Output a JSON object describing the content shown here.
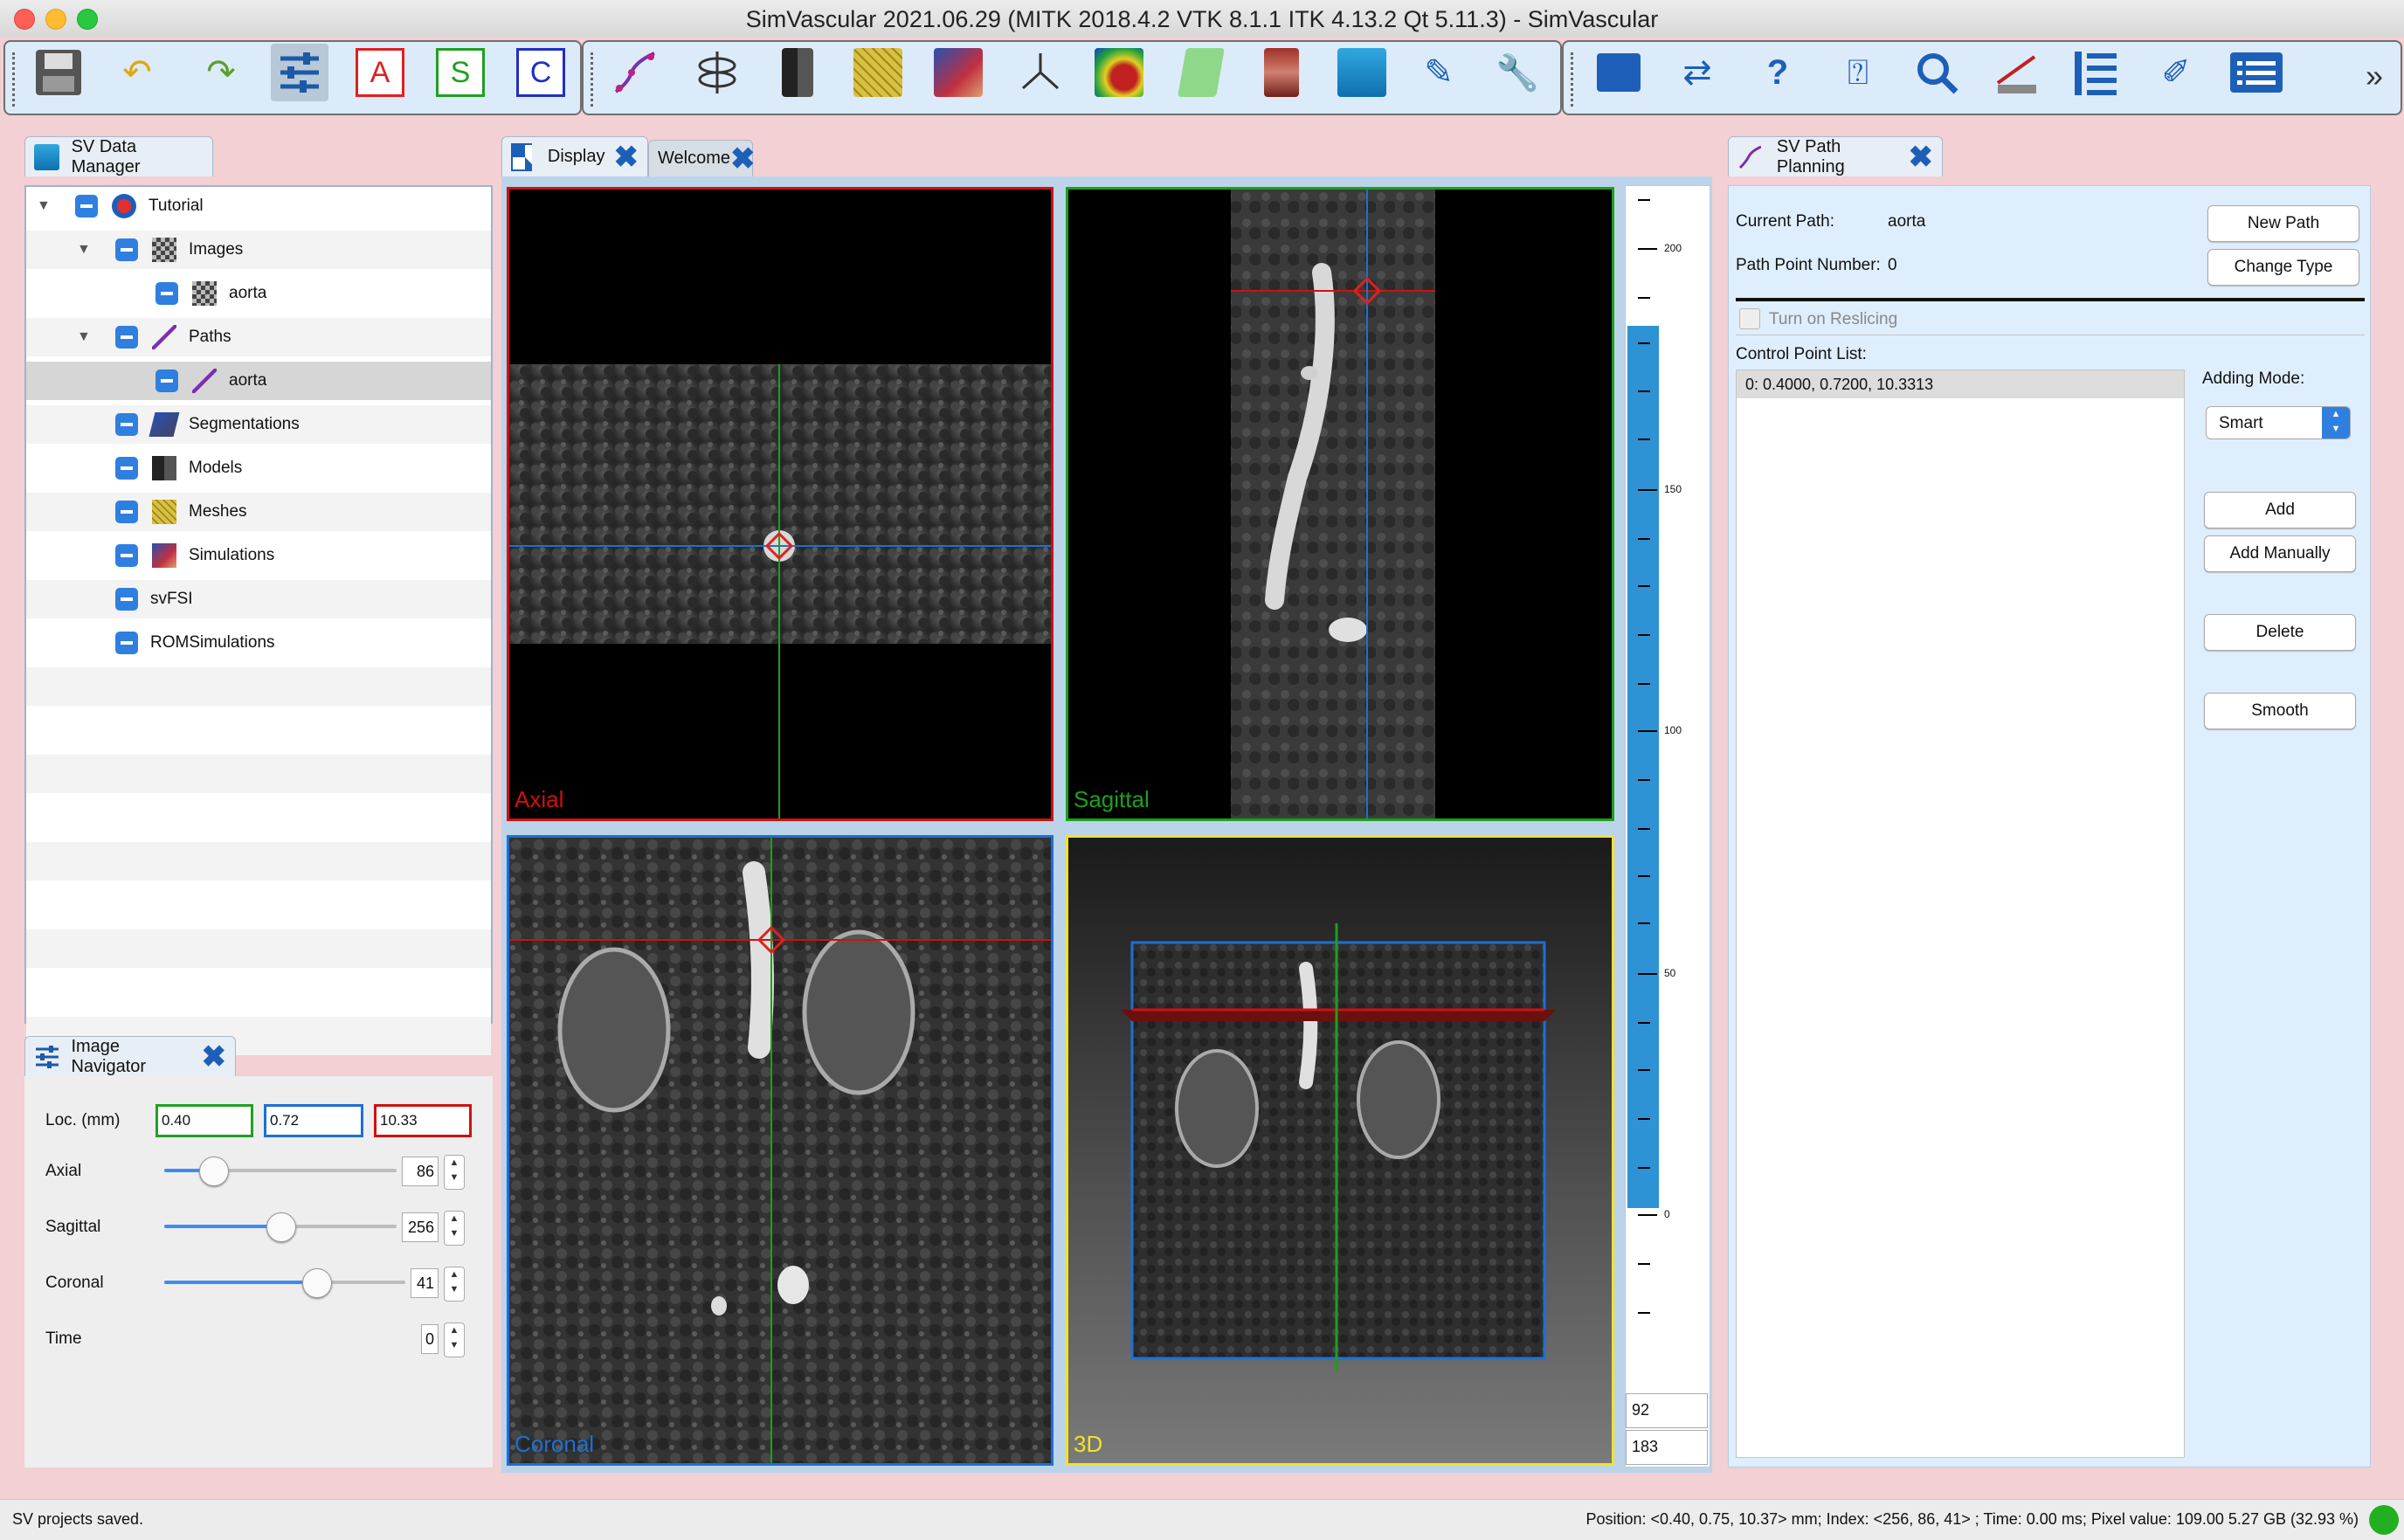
{
  "window": {
    "title": "SimVascular 2021.06.29 (MITK 2018.4.2 VTK 8.1.1 ITK 4.13.2 Qt 5.11.3) - SimVascular"
  },
  "toolbar": {
    "letters": [
      "A",
      "S",
      "C"
    ],
    "overflow": "»",
    "icons": [
      "save-icon",
      "undo-icon",
      "redo-icon",
      "image-navigator-icon",
      "axial-icon",
      "sagittal-icon",
      "coronal-icon",
      "path-planning-icon",
      "segmentation-icon",
      "model-icon",
      "mesh-icon",
      "simulation-icon",
      "centerline-icon",
      "image-icon",
      "surface-icon",
      "anatomy-icon",
      "database-icon",
      "edit-icon",
      "tools-icon",
      "archive-icon",
      "transfer-icon",
      "help-icon",
      "help-dialog-icon",
      "search-icon",
      "measure-icon",
      "log-icon",
      "settings-icon",
      "list-icon"
    ]
  },
  "data_manager": {
    "tab_label": "SV Data Manager",
    "tree": [
      {
        "label": "Tutorial",
        "level": 0,
        "expanded": true
      },
      {
        "label": "Images",
        "level": 1,
        "expanded": true
      },
      {
        "label": "aorta",
        "level": 2
      },
      {
        "label": "Paths",
        "level": 1,
        "expanded": true
      },
      {
        "label": "aorta",
        "level": 2,
        "selected": true
      },
      {
        "label": "Segmentations",
        "level": 1
      },
      {
        "label": "Models",
        "level": 1
      },
      {
        "label": "Meshes",
        "level": 1
      },
      {
        "label": "Simulations",
        "level": 1
      },
      {
        "label": "svFSI",
        "level": 1
      },
      {
        "label": "ROMSimulations",
        "level": 1
      }
    ]
  },
  "image_navigator": {
    "tab_label": "Image Navigator",
    "loc_label": "Loc. (mm)",
    "loc_values": [
      "0.40",
      "0.72",
      "10.33"
    ],
    "axial_label": "Axial",
    "axial_value": "86",
    "axial_fraction": 0.21,
    "sagittal_label": "Sagittal",
    "sagittal_value": "256",
    "sagittal_fraction": 0.5,
    "coronal_label": "Coronal",
    "coronal_value": "41",
    "coronal_fraction": 0.63,
    "time_label": "Time",
    "time_value": "0"
  },
  "display": {
    "tab_display": "Display",
    "tab_welcome": "Welcome",
    "views": {
      "axial": "Axial",
      "sagittal": "Sagittal",
      "coronal": "Coronal",
      "three_d": "3D"
    },
    "levelwindow": {
      "ticks": [
        "200",
        "150",
        "100",
        "50",
        "0"
      ],
      "level": "92",
      "window": "183"
    }
  },
  "path_planning": {
    "tab_label": "SV Path Planning",
    "current_path_label": "Current Path:",
    "current_path_value": "aorta",
    "point_number_label": "Path Point Number:",
    "point_number_value": "0",
    "new_path_button": "New Path",
    "change_type_button": "Change Type",
    "reslicing_label": "Turn on Reslicing",
    "control_point_list_label": "Control Point List:",
    "control_points": [
      "0:  0.4000,  0.7200,  10.3313"
    ],
    "adding_mode_label": "Adding Mode:",
    "adding_mode_value": "Smart",
    "add_button": "Add",
    "add_manually_button": "Add Manually",
    "delete_button": "Delete",
    "smooth_button": "Smooth"
  },
  "status": {
    "left": "SV projects saved.",
    "right": "Position: <0.40, 0.75, 10.37> mm; Index: <256, 86, 41> ; Time: 0.00 ms; Pixel value: 109.00   5.27 GB (32.93 %)"
  },
  "colors": {
    "axial": "#d11010",
    "sagittal": "#1ca01c",
    "coronal": "#1d6fd6",
    "three_d": "#f2e324",
    "accent": "#2f7fe0",
    "levelwindow": "#2d93d4"
  }
}
